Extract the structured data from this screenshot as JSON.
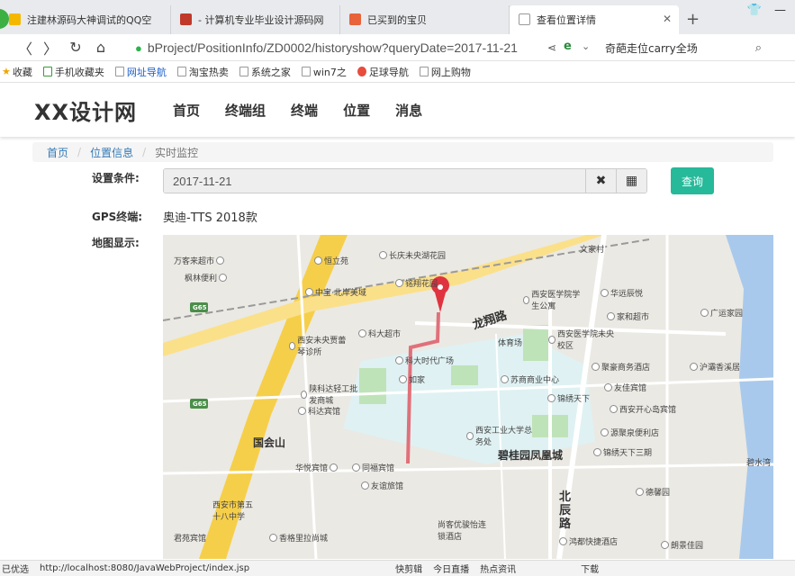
{
  "browser": {
    "tabs": [
      {
        "title": "注建林源码大神调试的QQ空",
        "color": "#f5b800"
      },
      {
        "title": "- 计算机专业毕业设计源码网",
        "color": "#c0392b"
      },
      {
        "title": "已买到的宝贝",
        "color": "#e8623a"
      },
      {
        "title": "查看位置详情",
        "color": "#bbbbbb"
      }
    ],
    "url": "bProject/PositionInfo/ZD0002/historyshow?queryDate=2017-11-21",
    "search_text": "奇葩走位carry全场",
    "bookmarks": [
      "收藏",
      "手机收藏夹",
      "网址导航",
      "淘宝热卖",
      "系统之家",
      "win7之",
      "足球导航",
      "网上购物"
    ]
  },
  "site": {
    "logo": "XX设计网",
    "nav": [
      "首页",
      "终端组",
      "终端",
      "位置",
      "消息"
    ]
  },
  "breadcrumb": [
    "首页",
    "位置信息",
    "实时监控"
  ],
  "form": {
    "condition_label": "设置条件:",
    "date_value": "2017-11-21",
    "query_button": "查询",
    "gps_label": "GPS终端:",
    "gps_value": "奥迪-TTS 2018款",
    "map_label": "地图显示:"
  },
  "map": {
    "pois": [
      "万客来超市",
      "恒立苑",
      "长庆未央湖花园",
      "枫林便利",
      "中宝·北岸美域",
      "铭翔花园",
      "西安医学院学生公寓",
      "华远辰悦",
      "家和超市",
      "广运家园",
      "西安未央贾蕾琴诊所",
      "科大超市",
      "体育场",
      "西安医学院未央校区",
      "科大时代广场",
      "聚豪商务酒店",
      "沪灞香溪居",
      "陕科达轻工批发商城",
      "如家",
      "苏商商业中心",
      "锦绣天下",
      "友佳宾馆",
      "科达宾馆",
      "西安开心岛宾馆",
      "西安工业大学总务处",
      "源聚泉便利店",
      "华悦宾馆",
      "同福宾馆",
      "锦绣天下三期",
      "友谊旅馆",
      "德馨园",
      "西安市第五十八中学",
      "尚客优骏怡连锁酒店",
      "鸿都快捷酒店",
      "君苑宾馆",
      "香格里拉尚城",
      "朗景佳园",
      "文家村"
    ],
    "road_labels": [
      "龙翔路",
      "北辰路",
      "国会山",
      "碧桂园凤凰城",
      "G65",
      "碧水湾"
    ]
  },
  "status": {
    "left": "已优选",
    "url": "http://localhost:8080/JavaWebProject/index.jsp",
    "items": [
      "快剪辑",
      "今日直播",
      "热点资讯",
      "下载"
    ]
  }
}
